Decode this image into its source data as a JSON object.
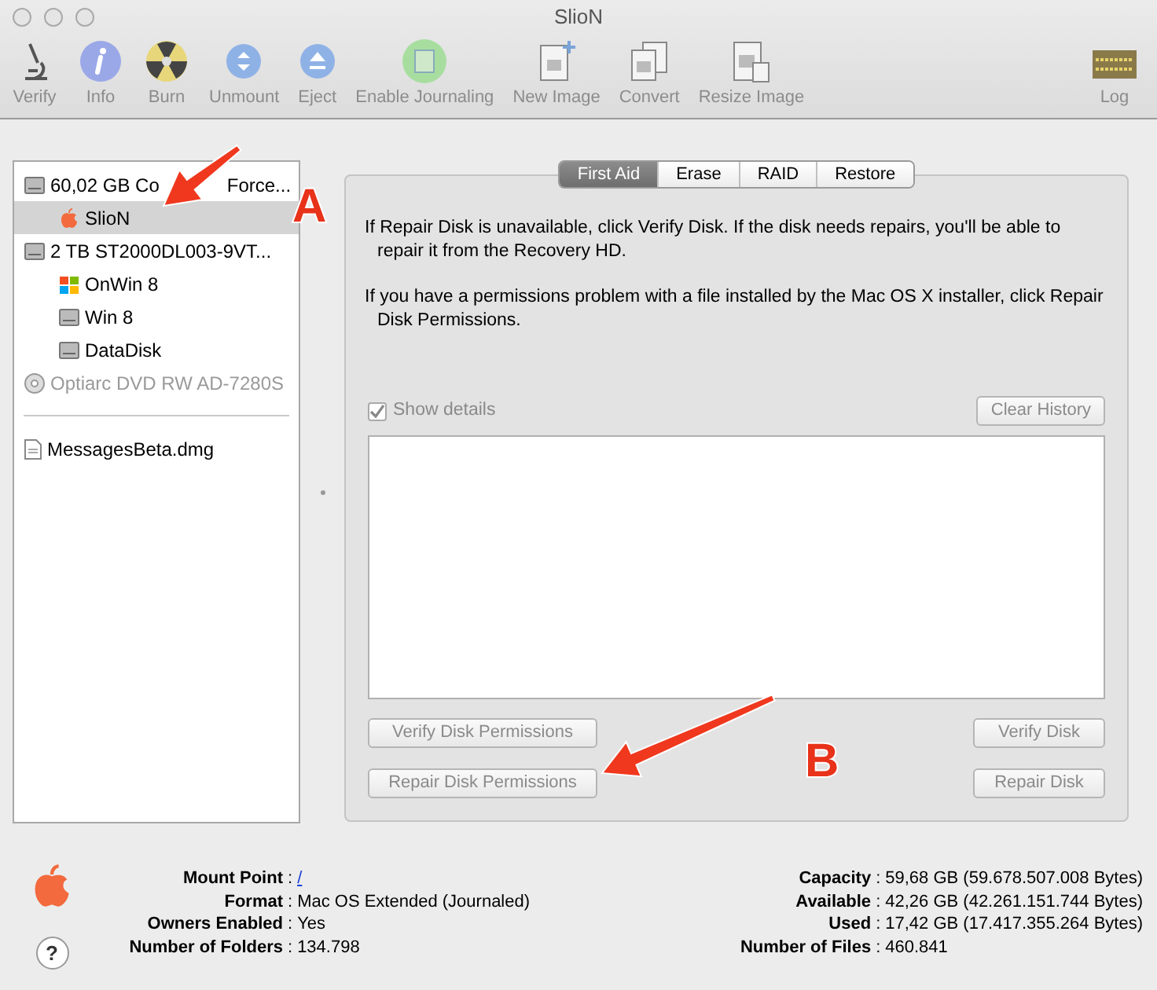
{
  "window": {
    "title": "SlioN"
  },
  "toolbar": [
    {
      "label": "Verify",
      "kind": "microscope"
    },
    {
      "label": "Info",
      "kind": "info"
    },
    {
      "label": "Burn",
      "kind": "burn"
    },
    {
      "label": "Unmount",
      "kind": "unmount"
    },
    {
      "label": "Eject",
      "kind": "eject"
    },
    {
      "label": "Enable Journaling",
      "kind": "journal"
    },
    {
      "label": "New Image",
      "kind": "newimage"
    },
    {
      "label": "Convert",
      "kind": "convert"
    },
    {
      "label": "Resize Image",
      "kind": "resize"
    }
  ],
  "log_button": {
    "label": "Log"
  },
  "sidebar": {
    "items": [
      {
        "kind": "drive",
        "label": "60,02 GB Co",
        "label_after_arrow": "Force...",
        "selected": false,
        "disabled": false,
        "children": [
          {
            "kind": "apple",
            "label": "SlioN",
            "selected": true,
            "disabled": false
          }
        ]
      },
      {
        "kind": "drive",
        "label": "2 TB ST2000DL003-9VT...",
        "selected": false,
        "disabled": false,
        "children": [
          {
            "kind": "windows",
            "label": "OnWin 8",
            "selected": false,
            "disabled": false
          },
          {
            "kind": "drive",
            "label": "Win 8",
            "selected": false,
            "disabled": false
          },
          {
            "kind": "drive",
            "label": "DataDisk",
            "selected": false,
            "disabled": false
          }
        ]
      },
      {
        "kind": "optical",
        "label": "Optiarc DVD RW AD-7280S",
        "selected": false,
        "disabled": true
      }
    ],
    "images": [
      {
        "kind": "file",
        "label": "MessagesBeta.dmg",
        "selected": false,
        "disabled": false
      }
    ]
  },
  "tabs": [
    {
      "label": "First Aid",
      "selected": true
    },
    {
      "label": "Erase",
      "selected": false
    },
    {
      "label": "RAID",
      "selected": false
    },
    {
      "label": "Restore",
      "selected": false
    }
  ],
  "first_aid": {
    "paragraphs": [
      "If Repair Disk is unavailable, click Verify Disk. If the disk needs repairs, you'll be able to repair it from the Recovery HD.",
      "If you have a permissions problem with a file installed by the Mac OS X installer, click Repair Disk Permissions."
    ],
    "show_details": {
      "label": "Show details",
      "checked": true,
      "disabled": true
    },
    "clear_history": {
      "label": "Clear History",
      "disabled": true
    },
    "buttons_left": [
      {
        "label": "Verify Disk Permissions",
        "disabled": true
      },
      {
        "label": "Repair Disk Permissions",
        "disabled": true
      }
    ],
    "buttons_right": [
      {
        "label": "Verify Disk",
        "disabled": true
      },
      {
        "label": "Repair Disk",
        "disabled": true
      }
    ]
  },
  "annotations": [
    {
      "letter": "A"
    },
    {
      "letter": "B"
    }
  ],
  "info": {
    "left": [
      {
        "label": "Mount Point",
        "value": "/",
        "kind": "link"
      },
      {
        "label": "Format",
        "value": "Mac OS Extended (Journaled)",
        "kind": "text"
      },
      {
        "label": "Owners Enabled",
        "value": "Yes",
        "kind": "text"
      },
      {
        "label": "Number of Folders",
        "value": "134.798",
        "kind": "text"
      }
    ],
    "right": [
      {
        "label": "Capacity",
        "value": "59,68 GB (59.678.507.008 Bytes)",
        "kind": "text"
      },
      {
        "label": "Available",
        "value": "42,26 GB (42.261.151.744 Bytes)",
        "kind": "text"
      },
      {
        "label": "Used",
        "value": "17,42 GB (17.417.355.264 Bytes)",
        "kind": "text"
      },
      {
        "label": "Number of Files",
        "value": "460.841",
        "kind": "text"
      }
    ],
    "colon": ":"
  },
  "help_button": {
    "label": "?"
  }
}
